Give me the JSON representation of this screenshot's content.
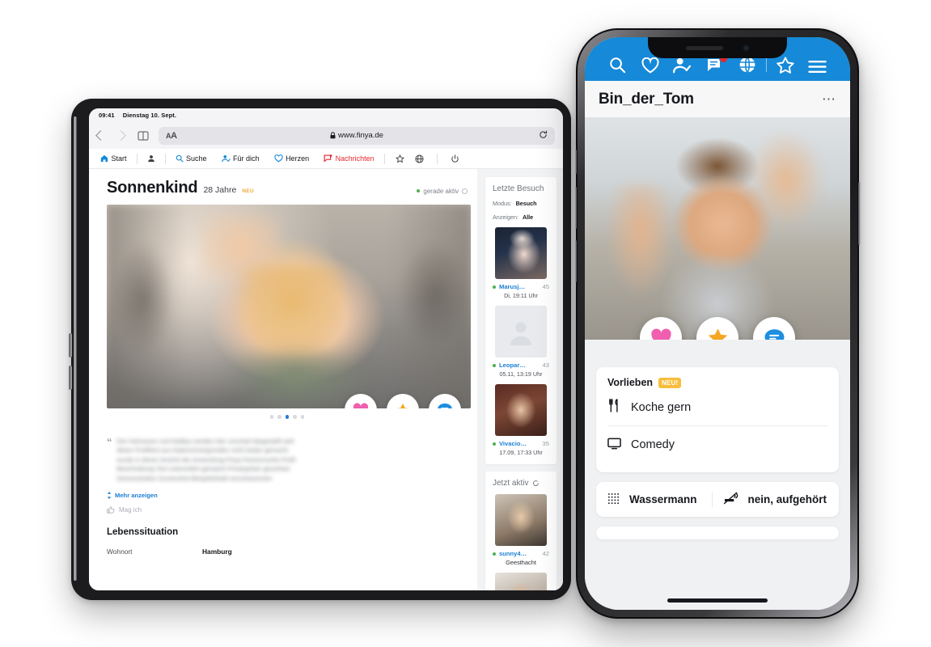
{
  "tablet": {
    "status_bar": {
      "time": "09:41",
      "date": "Dienstag 10. Sept."
    },
    "browser": {
      "text_size_label": "AA",
      "url": "www.finya.de",
      "lock_icon": "lock-icon",
      "reload_icon": "reload-icon",
      "back_icon": "back-arrow-icon",
      "forward_icon": "forward-arrow-icon",
      "bookmarks_icon": "book-icon"
    },
    "site_nav": {
      "items": [
        {
          "label": "Start",
          "icon": "home-icon"
        },
        {
          "label": "",
          "icon": "person-icon"
        },
        {
          "label": "Suche",
          "icon": "search-icon"
        },
        {
          "label": "Für dich",
          "icon": "person-add-icon"
        },
        {
          "label": "Herzen",
          "icon": "heart-outline-icon"
        },
        {
          "label": "Nachrichten",
          "icon": "chat-flag-icon"
        }
      ],
      "right_icons": [
        "star-outline-icon",
        "globe-icon",
        "power-icon"
      ]
    },
    "profile": {
      "name": "Sonnenkind",
      "age": "28 Jahre",
      "new_badge": "NEU",
      "status": "gerade aktiv",
      "carousel_dots": 5,
      "carousel_active": 3,
      "actions": [
        {
          "name": "like-heart-button",
          "icon": "heart-icon",
          "color": "#ef5fae"
        },
        {
          "name": "favorite-star-button",
          "icon": "star-icon",
          "color": "#f5a623"
        },
        {
          "name": "message-button",
          "icon": "chat-icon",
          "color": "#1e8fe0"
        }
      ],
      "bio_lines": [
        "ihre Interessen und Hobbys werden hier unscharf dargestellt weil",
        "dieser Profiltext aus Datenschutzgründen nicht lesbar gemacht",
        "wurde in dieser Ansicht der Anwendung Finya Partnersuche Profil",
        "Beschreibung Text unkenntlich gemacht Privatsphäre geschützt",
        "Demonstration Screenshot Beispielinhalt verschwommen"
      ],
      "more_link": "Mehr anzeigen",
      "like_link": "Mag ich",
      "section_title": "Lebenssituation",
      "rows": [
        {
          "key": "Wohnort",
          "value": "Hamburg"
        }
      ]
    },
    "sidebar": {
      "visitors_card": {
        "title": "Letzte Besuch",
        "mode_label": "Modus:",
        "mode_value": "Besuch",
        "show_label": "Anzeigen:",
        "show_value": "Alle",
        "items": [
          {
            "name": "Marusj…",
            "age": "45",
            "time": "Di, 19:11 Uhr"
          },
          {
            "name": "Leopar…",
            "age": "43",
            "time": "05.11, 13:19 Uhr"
          },
          {
            "name": "Vivacio…",
            "age": "35",
            "time": "17.09, 17:33 Uhr"
          }
        ]
      },
      "active_card": {
        "title": "Jetzt aktiv",
        "items": [
          {
            "name": "sunny4…",
            "age": "42",
            "city": "Geesthacht"
          }
        ]
      }
    }
  },
  "phone": {
    "nav_icons": [
      {
        "name": "search-icon"
      },
      {
        "name": "heart-outline-icon"
      },
      {
        "name": "person-check-icon"
      },
      {
        "name": "messages-icon",
        "badge": true
      },
      {
        "name": "globe-icon"
      },
      {
        "name": "star-outline-icon"
      },
      {
        "name": "hamburger-menu-icon"
      }
    ],
    "header": {
      "title": "Bin_der_Tom",
      "menu_icon": "more-options-icon"
    },
    "actions": [
      {
        "name": "like-heart-button",
        "icon": "heart-icon",
        "color": "#ef5fae"
      },
      {
        "name": "favorite-star-button",
        "icon": "star-icon",
        "color": "#f5a623"
      },
      {
        "name": "message-button",
        "icon": "chat-icon",
        "color": "#1e8fe0"
      }
    ],
    "preferences_card": {
      "title": "Vorlieben",
      "badge": "NEU!",
      "rows": [
        {
          "label": "Koche gern",
          "icon": "cutlery-icon"
        },
        {
          "label": "Comedy",
          "icon": "tv-icon"
        }
      ]
    },
    "facts_card": {
      "zodiac": {
        "label": "Wassermann",
        "icon": "zodiac-aquarius-icon"
      },
      "smoking": {
        "label": "nein, aufgehört",
        "icon": "no-smoking-icon"
      }
    }
  },
  "colors": {
    "brand_blue": "#1689d8",
    "link_blue": "#1a7fd4",
    "accent_yellow": "#f7bd3c",
    "alert_red": "#e3262b",
    "heart_pink": "#ef5fae",
    "star_orange": "#f5a623",
    "online_green": "#4caf50"
  }
}
